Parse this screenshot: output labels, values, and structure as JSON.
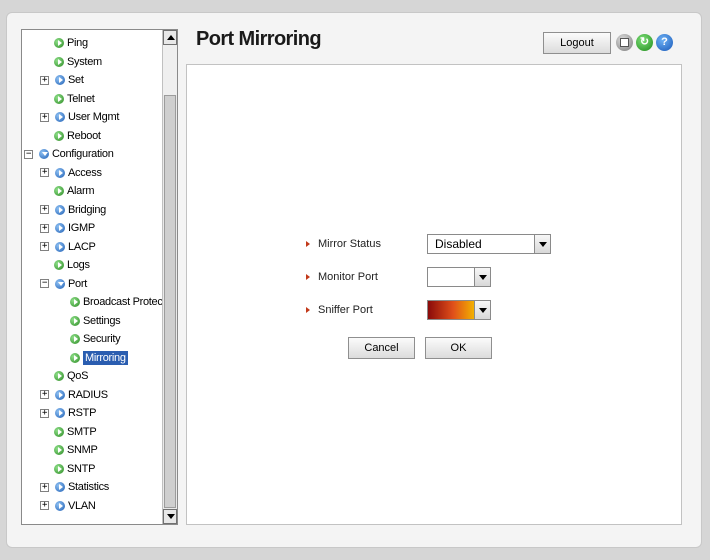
{
  "header": {
    "title": "Port Mirroring",
    "logout_label": "Logout",
    "icons": [
      "save-icon",
      "refresh-icon",
      "help-icon"
    ]
  },
  "nav_tree": [
    {
      "label": "Ping",
      "level": 1,
      "expander": "",
      "icon": "green",
      "selected": false
    },
    {
      "label": "System",
      "level": 1,
      "expander": "",
      "icon": "green",
      "selected": false
    },
    {
      "label": "Set",
      "level": 1,
      "expander": "+",
      "icon": "blue",
      "selected": false
    },
    {
      "label": "Telnet",
      "level": 1,
      "expander": "",
      "icon": "green",
      "selected": false
    },
    {
      "label": "User Mgmt",
      "level": 1,
      "expander": "+",
      "icon": "blue",
      "selected": false
    },
    {
      "label": "Reboot",
      "level": 1,
      "expander": "",
      "icon": "green",
      "selected": false
    },
    {
      "label": "Configuration",
      "level": 0,
      "expander": "−",
      "icon": "folder-open",
      "selected": false
    },
    {
      "label": "Access",
      "level": 1,
      "expander": "+",
      "icon": "blue",
      "selected": false
    },
    {
      "label": "Alarm",
      "level": 1,
      "expander": "",
      "icon": "green",
      "selected": false
    },
    {
      "label": "Bridging",
      "level": 1,
      "expander": "+",
      "icon": "blue",
      "selected": false
    },
    {
      "label": "IGMP",
      "level": 1,
      "expander": "+",
      "icon": "blue",
      "selected": false
    },
    {
      "label": "LACP",
      "level": 1,
      "expander": "+",
      "icon": "blue",
      "selected": false
    },
    {
      "label": "Logs",
      "level": 1,
      "expander": "",
      "icon": "green",
      "selected": false
    },
    {
      "label": "Port",
      "level": 1,
      "expander": "−",
      "icon": "folder-open",
      "selected": false
    },
    {
      "label": "Broadcast Protect",
      "level": 2,
      "expander": "",
      "icon": "green",
      "selected": false
    },
    {
      "label": "Settings",
      "level": 2,
      "expander": "",
      "icon": "green",
      "selected": false
    },
    {
      "label": "Security",
      "level": 2,
      "expander": "",
      "icon": "green",
      "selected": false
    },
    {
      "label": "Mirroring",
      "level": 2,
      "expander": "",
      "icon": "green",
      "selected": true
    },
    {
      "label": "QoS",
      "level": 1,
      "expander": "",
      "icon": "green",
      "selected": false
    },
    {
      "label": "RADIUS",
      "level": 1,
      "expander": "+",
      "icon": "blue",
      "selected": false
    },
    {
      "label": "RSTP",
      "level": 1,
      "expander": "+",
      "icon": "blue",
      "selected": false
    },
    {
      "label": "SMTP",
      "level": 1,
      "expander": "",
      "icon": "green",
      "selected": false
    },
    {
      "label": "SNMP",
      "level": 1,
      "expander": "",
      "icon": "green",
      "selected": false
    },
    {
      "label": "SNTP",
      "level": 1,
      "expander": "",
      "icon": "green",
      "selected": false
    },
    {
      "label": "Statistics",
      "level": 1,
      "expander": "+",
      "icon": "blue",
      "selected": false
    },
    {
      "label": "VLAN",
      "level": 1,
      "expander": "+",
      "icon": "blue",
      "selected": false
    }
  ],
  "form": {
    "mirror_status_label": "Mirror Status",
    "mirror_status_value": "Disabled",
    "monitor_port_label": "Monitor Port",
    "monitor_port_value": "",
    "sniffer_port_label": "Sniffer Port",
    "sniffer_port_value": "",
    "cancel_label": "Cancel",
    "ok_label": "OK"
  },
  "colors": {
    "selection": "#2a5db0",
    "marker": "#c23a1a"
  }
}
